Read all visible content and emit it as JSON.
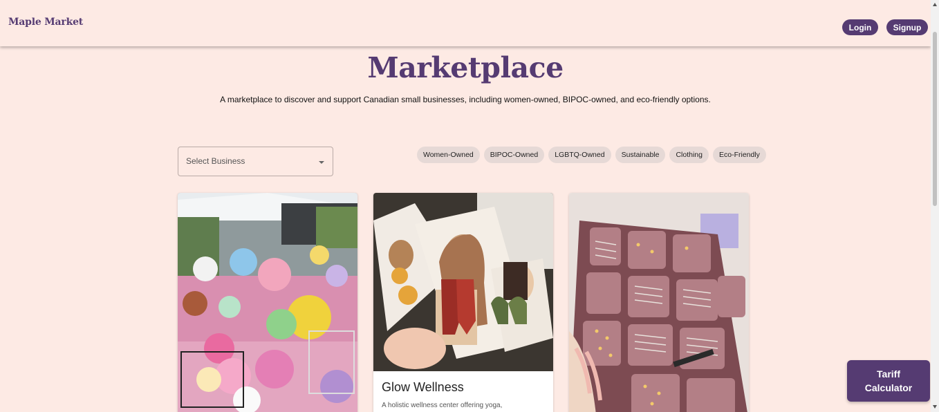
{
  "header": {
    "logo": "Maple Market",
    "login_label": "Login",
    "signup_label": "Signup"
  },
  "hero": {
    "title": "Marketplace",
    "subtitle": "A marketplace to discover and support Canadian small businesses, including women-owned, BIPOC-owned, and eco-friendly options."
  },
  "filters": {
    "select_placeholder": "Select Business",
    "tags": [
      "Women-Owned",
      "BIPOC-Owned",
      "LGBTQ-Owned",
      "Sustainable",
      "Clothing",
      "Eco-Friendly"
    ]
  },
  "cards": [
    {
      "image_icon": "crochet-plushies-photo",
      "title": "",
      "description": ""
    },
    {
      "image_icon": "clay-earrings-photo",
      "title": "Glow Wellness",
      "description": "A holistic wellness center offering yoga,"
    },
    {
      "image_icon": "jewelry-tray-photo",
      "title": "",
      "description": ""
    }
  ],
  "floating": {
    "tariff_line1": "Tariff",
    "tariff_line2": "Calculator"
  },
  "colors": {
    "background": "#fdeae4",
    "brand": "#553b72",
    "chip": "#e6d9d6"
  }
}
